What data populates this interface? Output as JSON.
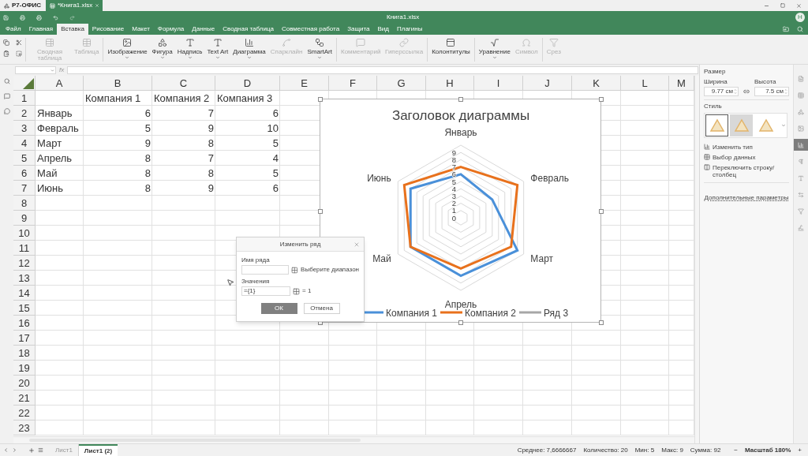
{
  "app_tabs": [
    {
      "label": "Р7-ОФИС",
      "selected": false
    },
    {
      "label": "*Книга1.xlsx",
      "selected": true
    }
  ],
  "header": {
    "title": "Книга1.xlsx",
    "avatar": "Н"
  },
  "menu_tabs": [
    {
      "label": "Файл",
      "selected": false
    },
    {
      "label": "Главная",
      "selected": false
    },
    {
      "label": "Вставка",
      "selected": true
    },
    {
      "label": "Рисование",
      "selected": false
    },
    {
      "label": "Макет",
      "selected": false
    },
    {
      "label": "Формула",
      "selected": false
    },
    {
      "label": "Данные",
      "selected": false
    },
    {
      "label": "Сводная таблица",
      "selected": false
    },
    {
      "label": "Совместная работа",
      "selected": false
    },
    {
      "label": "Защита",
      "selected": false
    },
    {
      "label": "Вид",
      "selected": false
    },
    {
      "label": "Плагины",
      "selected": false
    }
  ],
  "toolbar": {
    "groups": [
      [
        {
          "label": "Сводная таблица",
          "disabled": true,
          "has_menu": false
        },
        {
          "label": "Таблица",
          "disabled": true,
          "has_menu": false
        }
      ],
      [
        {
          "label": "Изображение",
          "disabled": false,
          "has_menu": true
        },
        {
          "label": "Фигура",
          "disabled": false,
          "has_menu": true
        },
        {
          "label": "Надпись",
          "disabled": false,
          "has_menu": true
        },
        {
          "label": "Text Art",
          "disabled": false,
          "has_menu": true
        },
        {
          "label": "Диаграмма",
          "disabled": false,
          "has_menu": true
        },
        {
          "label": "Спарклайн",
          "disabled": true,
          "has_menu": false
        },
        {
          "label": "SmartArt",
          "disabled": false,
          "has_menu": true
        }
      ],
      [
        {
          "label": "Комментарий",
          "disabled": true,
          "has_menu": false
        },
        {
          "label": "Гиперссылка",
          "disabled": true,
          "has_menu": false
        }
      ],
      [
        {
          "label": "Колонтитулы",
          "disabled": false,
          "has_menu": false
        }
      ],
      [
        {
          "label": "Уравнение",
          "disabled": false,
          "has_menu": true
        },
        {
          "label": "Символ",
          "disabled": true,
          "has_menu": false
        }
      ],
      [
        {
          "label": "Срез",
          "disabled": true,
          "has_menu": false
        }
      ]
    ]
  },
  "formula_bar": {
    "fx_label": "fx"
  },
  "sheet": {
    "columns": [
      "A",
      "B",
      "C",
      "D",
      "E",
      "F",
      "G",
      "H",
      "I",
      "J",
      "K",
      "L",
      "M"
    ],
    "rows": [
      {
        "number": "1",
        "cells": [
          null,
          "Компания 1",
          "Компания 2",
          "Компания 3"
        ]
      },
      {
        "number": "2",
        "cells": [
          "Январь",
          "6",
          "7",
          "6"
        ]
      },
      {
        "number": "3",
        "cells": [
          "Февраль",
          "5",
          "9",
          "10"
        ]
      },
      {
        "number": "4",
        "cells": [
          "Март",
          "9",
          "8",
          "5"
        ]
      },
      {
        "number": "5",
        "cells": [
          "Апрель",
          "8",
          "7",
          "4"
        ]
      },
      {
        "number": "6",
        "cells": [
          "Май",
          "8",
          "8",
          "5"
        ]
      },
      {
        "number": "7",
        "cells": [
          "Июнь",
          "8",
          "9",
          "6"
        ]
      },
      {
        "number": "8"
      },
      {
        "number": "9"
      },
      {
        "number": "10"
      },
      {
        "number": "11"
      },
      {
        "number": "12"
      },
      {
        "number": "13"
      },
      {
        "number": "14"
      },
      {
        "number": "15"
      },
      {
        "number": "16"
      },
      {
        "number": "17"
      },
      {
        "number": "18"
      },
      {
        "number": "19"
      },
      {
        "number": "20"
      },
      {
        "number": "21"
      },
      {
        "number": "22"
      },
      {
        "number": "23"
      }
    ]
  },
  "chart": {
    "chart_data": {
      "type": "radar",
      "title": "Заголовок диаграммы",
      "categories": [
        "Январь",
        "Февраль",
        "Март",
        "Апрель",
        "Май",
        "Июнь"
      ],
      "series": [
        {
          "name": "Компания 1",
          "color": "#4a90d9",
          "values": [
            6,
            5,
            9,
            8,
            8,
            8
          ]
        },
        {
          "name": "Компания 2",
          "color": "#e8711c",
          "values": [
            7,
            9,
            8,
            7,
            8,
            9
          ]
        },
        {
          "name": "Ряд 3",
          "color": "#a6a6a6",
          "values": [
            null,
            null,
            null,
            null,
            null,
            null
          ]
        }
      ],
      "ylim": [
        0,
        10
      ],
      "yticks": [
        {
          "value": 0,
          "label": "0"
        },
        {
          "value": 1,
          "label": "1"
        },
        {
          "value": 2,
          "label": "2"
        },
        {
          "value": 3,
          "label": "3"
        },
        {
          "value": 4,
          "label": "4"
        },
        {
          "value": 5,
          "label": "5"
        },
        {
          "value": 6,
          "label": "6"
        },
        {
          "value": 7,
          "label": "7"
        },
        {
          "value": 8,
          "label": "8"
        },
        {
          "value": 9,
          "label": "9"
        }
      ],
      "legend": true
    }
  },
  "dialog": {
    "title": "Изменить ряд",
    "name_label": "Имя ряда",
    "range_hint": "Выберите диапазон",
    "values_label": "Значения",
    "values_value": "={1}",
    "values_result": "= 1",
    "ok": "ОК",
    "cancel": "Отмена"
  },
  "right_panel": {
    "size_title": "Размер",
    "width_label": "Ширина",
    "width_value": "9.77 см",
    "height_label": "Высота",
    "height_value": "7.5 см",
    "style_title": "Стиль",
    "styles": [
      {
        "selected": true
      },
      {
        "selected": false
      },
      {
        "selected": false
      }
    ],
    "actions": [
      "Изменить тип",
      "Выбор данных",
      "Переключить строку/столбец"
    ],
    "advanced": "Дополнительные параметры"
  },
  "right_icons": [
    {
      "selected": false
    },
    {
      "selected": false
    },
    {
      "selected": false
    },
    {
      "selected": false
    },
    {
      "selected": true
    },
    {
      "selected": false
    },
    {
      "selected": false
    },
    {
      "selected": false
    },
    {
      "selected": false
    },
    {
      "selected": false
    }
  ],
  "sheet_tabs": [
    {
      "label": "Лист1",
      "selected": false
    },
    {
      "label": "Лист1 (2)",
      "selected": true
    }
  ],
  "status": {
    "stats": [
      "Среднее: 7,6666667",
      "Количество: 20",
      "Мин: 5",
      "Макс: 9",
      "Сумма: 92"
    ],
    "zoom_out": "−",
    "zoom": "Масштаб 180%",
    "zoom_in": "+"
  }
}
